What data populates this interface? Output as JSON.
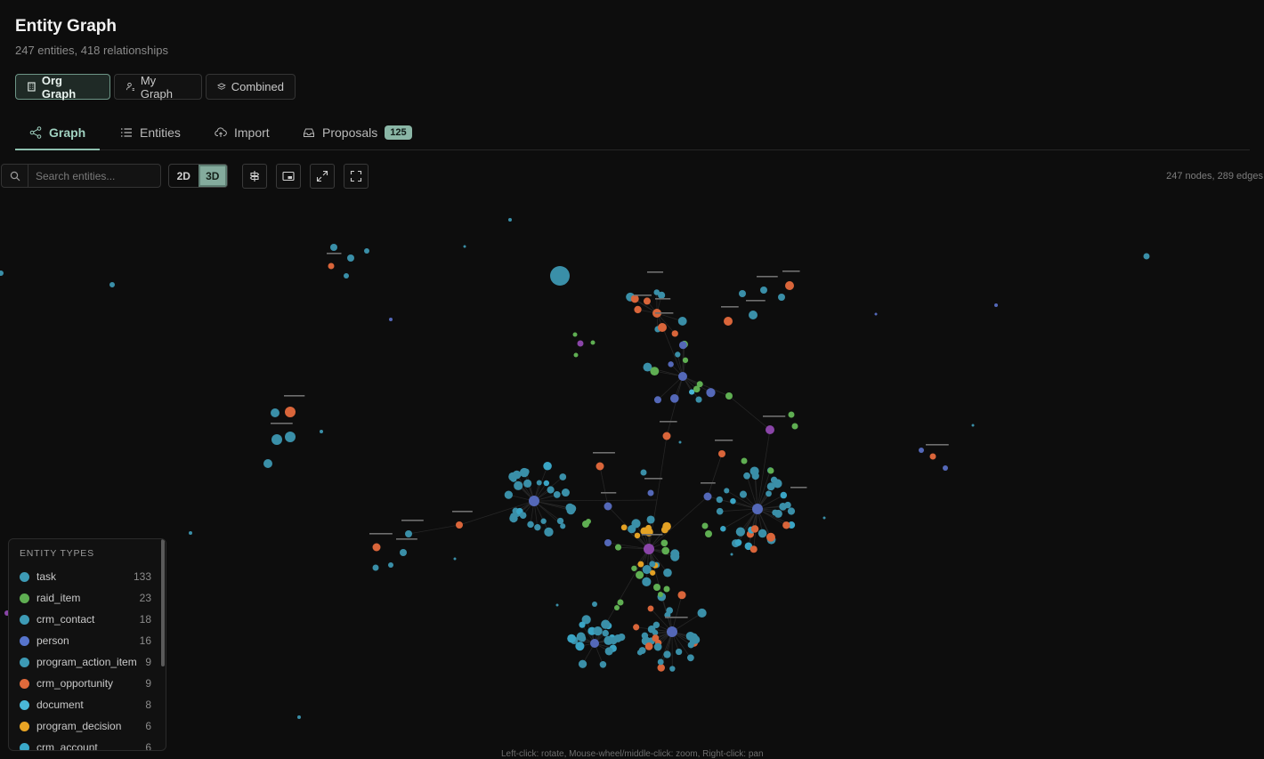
{
  "page": {
    "title": "Entity Graph",
    "subtitle": "247 entities, 418 relationships"
  },
  "scopes": [
    {
      "label": "Org Graph",
      "icon": "building-icon",
      "active": true
    },
    {
      "label": "My Graph",
      "icon": "user-network-icon",
      "active": false
    },
    {
      "label": "Combined",
      "icon": "layers-icon",
      "active": false
    }
  ],
  "tabs": [
    {
      "label": "Graph",
      "icon": "share-nodes-icon",
      "active": true
    },
    {
      "label": "Entities",
      "icon": "list-icon",
      "active": false
    },
    {
      "label": "Import",
      "icon": "cloud-upload-icon",
      "active": false
    },
    {
      "label": "Proposals",
      "icon": "inbox-icon",
      "badge": "125",
      "active": false
    }
  ],
  "toolbar": {
    "search_placeholder": "Search entities...",
    "view_2d": "2D",
    "view_3d": "3D",
    "active_view": "3D",
    "tools": [
      "signpost-icon",
      "minimap-icon",
      "expand-arrows-icon",
      "fullscreen-icon"
    ],
    "stats": "247 nodes, 289 edges"
  },
  "legend": {
    "title": "ENTITY TYPES",
    "items": [
      {
        "label": "task",
        "count": "133",
        "color": "#3d9ab5"
      },
      {
        "label": "raid_item",
        "count": "23",
        "color": "#5fae52"
      },
      {
        "label": "crm_contact",
        "count": "18",
        "color": "#3d9ab5"
      },
      {
        "label": "person",
        "count": "16",
        "color": "#5674cc"
      },
      {
        "label": "program_action_item",
        "count": "9",
        "color": "#3d9ab5"
      },
      {
        "label": "crm_opportunity",
        "count": "9",
        "color": "#e06a3b"
      },
      {
        "label": "document",
        "count": "8",
        "color": "#4ab8d8"
      },
      {
        "label": "program_decision",
        "count": "6",
        "color": "#e8a424"
      },
      {
        "label": "crm_account",
        "count": "6",
        "color": "#3aa8c8"
      }
    ]
  },
  "hint": "Left-click: rotate, Mouse-wheel/middle-click: zoom, Right-click: pan"
}
